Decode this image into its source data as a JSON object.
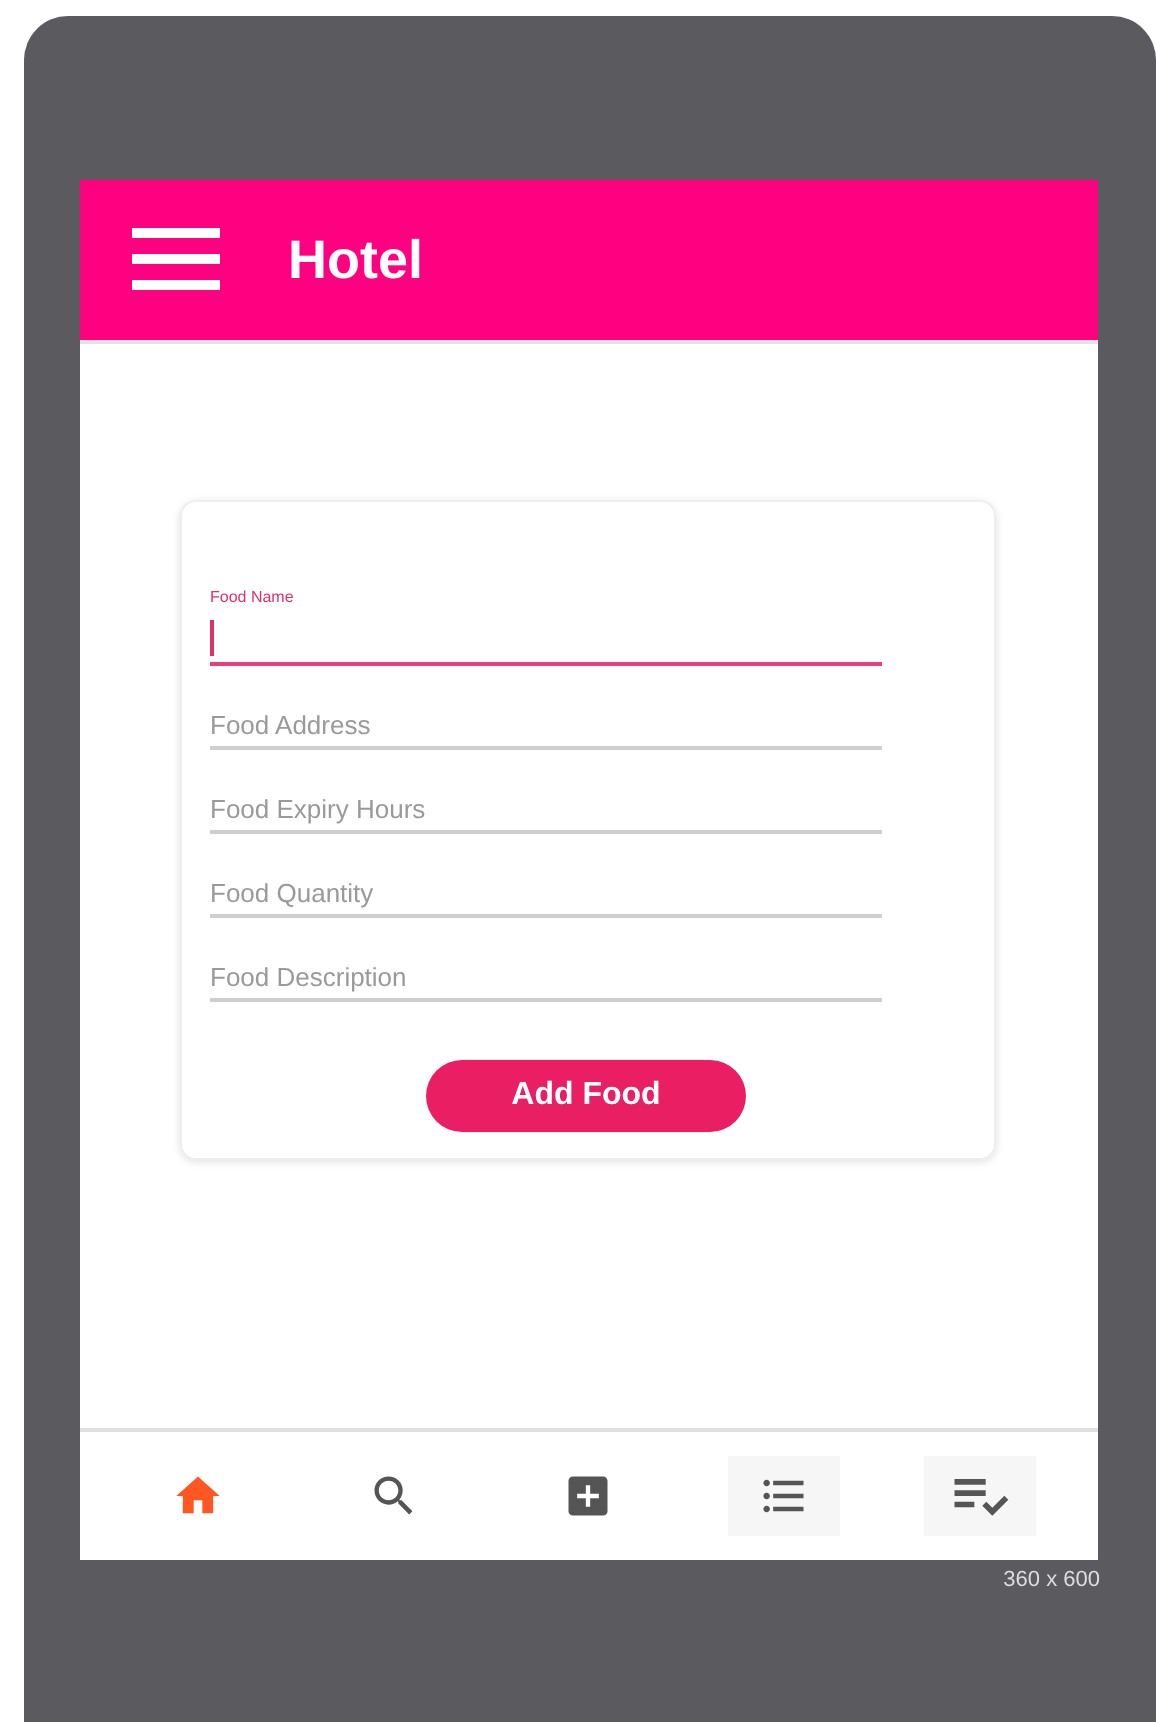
{
  "app_bar": {
    "title": "Hotel"
  },
  "form": {
    "fields": [
      {
        "placeholder": "Food Name",
        "focused": true
      },
      {
        "placeholder": "Food Address",
        "focused": false
      },
      {
        "placeholder": "Food Expiry Hours",
        "focused": false
      },
      {
        "placeholder": "Food Quantity",
        "focused": false
      },
      {
        "placeholder": "Food Description",
        "focused": false
      }
    ],
    "submit": "Add Food"
  },
  "bottom_nav": [
    {
      "kind": "home",
      "selected": true
    },
    {
      "kind": "search",
      "selected": false
    },
    {
      "kind": "add",
      "selected": false
    },
    {
      "kind": "list",
      "selected": false
    },
    {
      "kind": "checklist",
      "selected": false
    }
  ],
  "device_size": "360 x 600"
}
